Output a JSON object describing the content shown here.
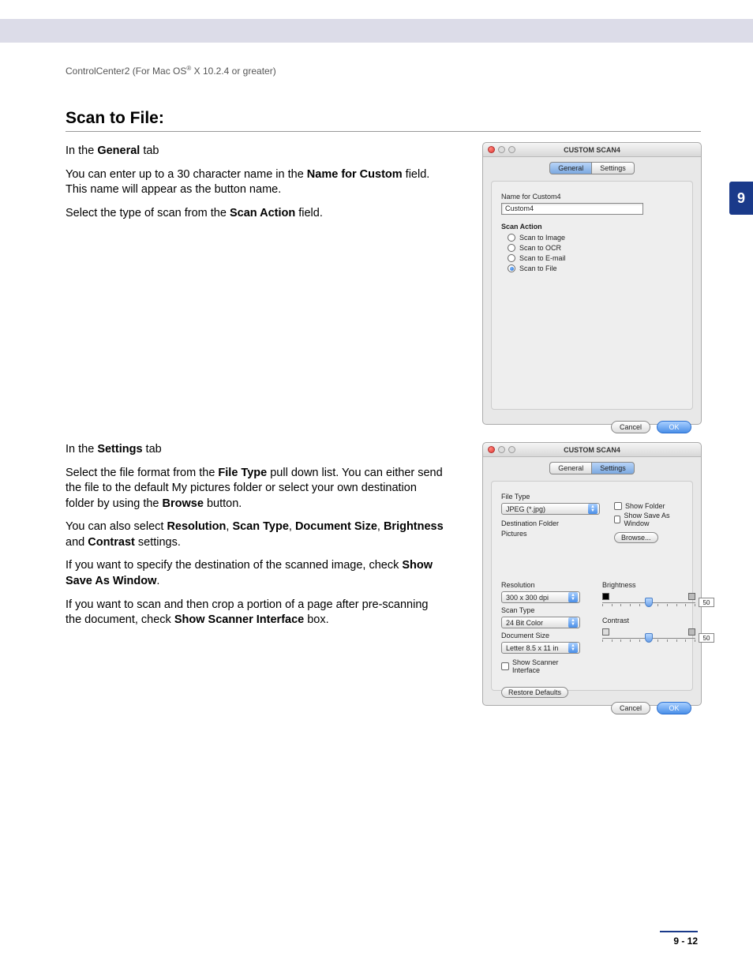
{
  "header": {
    "breadcrumb_pre": "ControlCenter2 (For Mac OS",
    "breadcrumb_sup": "®",
    "breadcrumb_post": " X 10.2.4 or greater)"
  },
  "chapter_tab": "9",
  "section_title": "Scan to File:",
  "body1": {
    "p1_pre": "In the ",
    "p1_bold": "General",
    "p1_post": " tab",
    "p2_pre": "You can enter up to a 30 character name in the ",
    "p2_bold": "Name for Custom",
    "p2_post": " field. This name will appear as the button name.",
    "p3_pre": "Select the type of scan from the ",
    "p3_bold": "Scan Action",
    "p3_post": " field."
  },
  "body2": {
    "p1_pre": "In the ",
    "p1_bold": "Settings",
    "p1_post": " tab",
    "p2_a": "Select the file format from the ",
    "p2_b": "File Type",
    "p2_c": " pull down list. You can either send the file to the default My pictures folder or select your own destination folder by using the ",
    "p2_d": "Browse",
    "p2_e": " button.",
    "p3_a": "You can also select ",
    "p3_b": "Resolution",
    "p3_c": ", ",
    "p3_d": "Scan Type",
    "p3_e": ", ",
    "p3_f": "Document Size",
    "p3_g": ", ",
    "p3_h": "Brightness",
    "p3_i": " and ",
    "p3_j": "Contrast",
    "p3_k": " settings.",
    "p4_a": "If you want to specify the destination of the scanned image, check ",
    "p4_b": "Show Save As Window",
    "p4_c": ".",
    "p5_a": "If you want to scan and then crop a portion of a page after pre-scanning the document, check ",
    "p5_b": "Show Scanner Interface",
    "p5_c": " box."
  },
  "dialog1": {
    "title": "CUSTOM SCAN4",
    "tab_general": "General",
    "tab_settings": "Settings",
    "name_label": "Name for Custom4",
    "name_value": "Custom4",
    "action_label": "Scan Action",
    "opt_image": "Scan to Image",
    "opt_ocr": "Scan to OCR",
    "opt_email": "Scan to E-mail",
    "opt_file": "Scan to File",
    "cancel": "Cancel",
    "ok": "OK"
  },
  "dialog2": {
    "title": "CUSTOM SCAN4",
    "tab_general": "General",
    "tab_settings": "Settings",
    "filetype_label": "File Type",
    "filetype_value": "JPEG (*.jpg)",
    "show_folder": "Show Folder",
    "show_save_as": "Show Save As Window",
    "dest_label": "Destination Folder",
    "dest_value": "Pictures",
    "browse": "Browse...",
    "res_label": "Resolution",
    "res_value": "300 x 300 dpi",
    "scantype_label": "Scan Type",
    "scantype_value": "24 Bit Color",
    "docsize_label": "Document Size",
    "docsize_value": "Letter  8.5 x 11 in",
    "show_scanner": "Show Scanner Interface",
    "brightness_label": "Brightness",
    "brightness_value": "50",
    "contrast_label": "Contrast",
    "contrast_value": "50",
    "restore": "Restore Defaults",
    "cancel": "Cancel",
    "ok": "OK"
  },
  "footer": "9 - 12"
}
